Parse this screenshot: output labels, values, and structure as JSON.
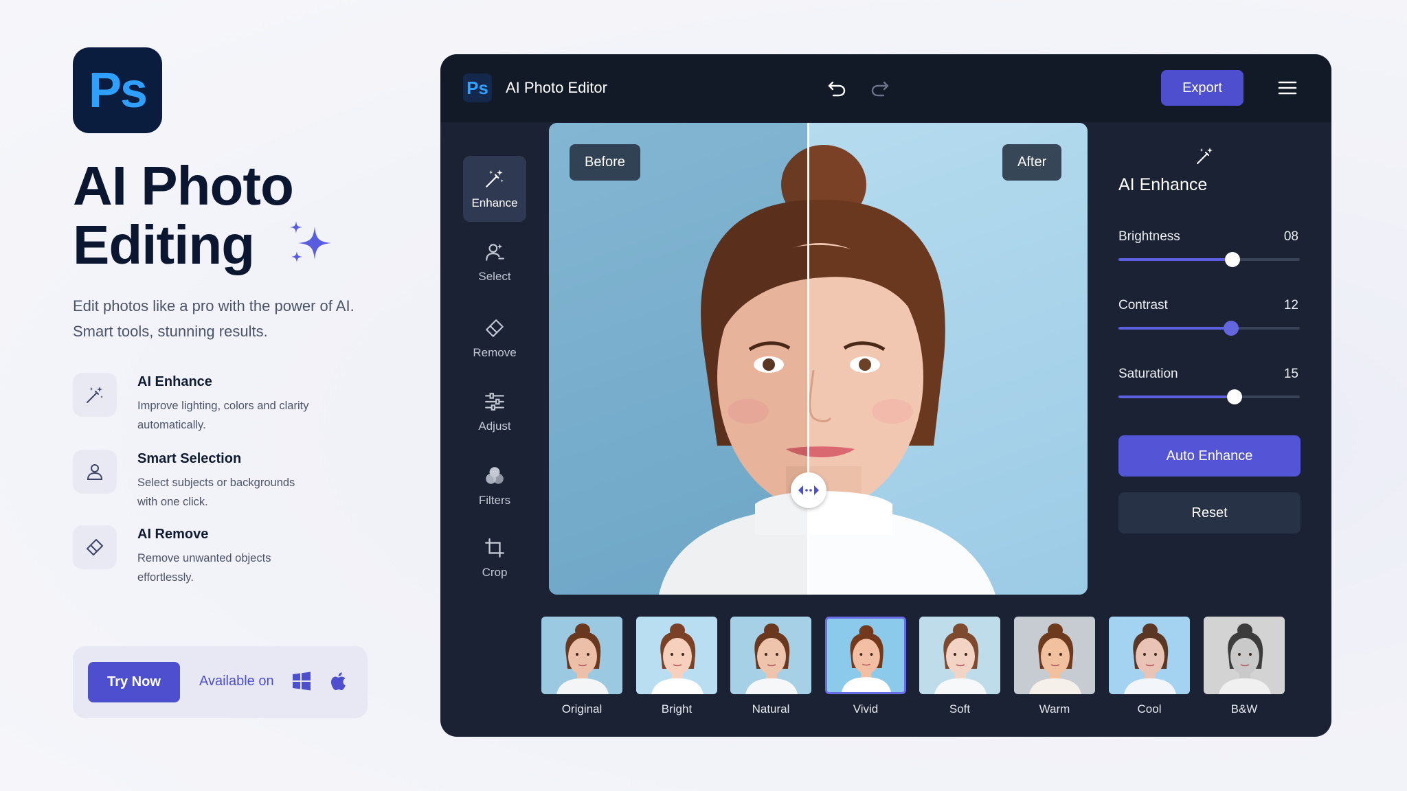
{
  "hero": {
    "logo_text": "Ps",
    "title_line1": "AI Photo",
    "title_line2": "Editing",
    "subtitle_line1": "Edit photos like a pro with the power of AI.",
    "subtitle_line2": "Smart tools, stunning results."
  },
  "features": [
    {
      "icon": "magic-wand-icon",
      "title": "AI Enhance",
      "desc_line1": "Improve lighting, colors and clarity",
      "desc_line2": "automatically."
    },
    {
      "icon": "person-select-icon",
      "title": "Smart Selection",
      "desc_line1": "Select subjects or backgrounds",
      "desc_line2": "with one click."
    },
    {
      "icon": "eraser-icon",
      "title": "AI Remove",
      "desc_line1": "Remove unwanted objects",
      "desc_line2": "effortlessly."
    }
  ],
  "cta": {
    "try_label": "Try Now",
    "available_label": "Available on",
    "platforms": [
      "windows-icon",
      "apple-icon"
    ]
  },
  "editor": {
    "logo_text": "Ps",
    "title": "AI Photo Editor",
    "export_label": "Export",
    "tools": [
      {
        "label": "Enhance",
        "icon": "magic-wand-icon",
        "active": true
      },
      {
        "label": "Select",
        "icon": "person-select-icon",
        "active": false
      },
      {
        "label": "Remove",
        "icon": "eraser-icon",
        "active": false
      },
      {
        "label": "Adjust",
        "icon": "sliders-icon",
        "active": false
      },
      {
        "label": "Filters",
        "icon": "filters-icon",
        "active": false
      },
      {
        "label": "Crop",
        "icon": "crop-icon",
        "active": false
      }
    ],
    "canvas": {
      "before_label": "Before",
      "after_label": "After"
    },
    "panel": {
      "title": "AI Enhance",
      "sliders": [
        {
          "label": "Brightness",
          "value": "08",
          "fraction": 0.63
        },
        {
          "label": "Contrast",
          "value": "12",
          "fraction": 0.62
        },
        {
          "label": "Saturation",
          "value": "15",
          "fraction": 0.64
        }
      ],
      "auto_label": "Auto Enhance",
      "reset_label": "Reset"
    },
    "filters": [
      {
        "name": "Original",
        "selected": false
      },
      {
        "name": "Bright",
        "selected": false
      },
      {
        "name": "Natural",
        "selected": false
      },
      {
        "name": "Vivid",
        "selected": true
      },
      {
        "name": "Soft",
        "selected": false
      },
      {
        "name": "Warm",
        "selected": false
      },
      {
        "name": "Cool",
        "selected": false
      },
      {
        "name": "B&W",
        "selected": false
      }
    ]
  },
  "colors": {
    "accent": "#4d4fcf",
    "editor_bg": "#1a2233",
    "topbar_bg": "#121a28",
    "ps_blue": "#31a3ff"
  }
}
